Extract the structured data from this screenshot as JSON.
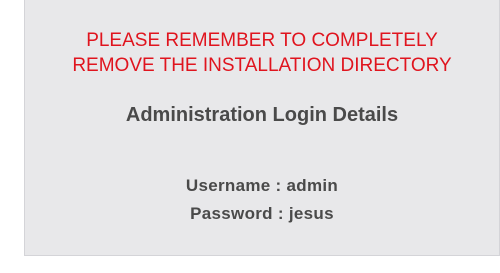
{
  "warning": {
    "line1": "PLEASE REMEMBER TO COMPLETELY",
    "line2": "REMOVE THE INSTALLATION DIRECTORY"
  },
  "login": {
    "heading": "Administration Login Details",
    "username_line": "Username : admin",
    "password_line": "Password : jesus"
  },
  "colors": {
    "warning_text": "#e0141e",
    "panel_background": "#e8e8ea",
    "body_text": "#4a4a4a"
  }
}
